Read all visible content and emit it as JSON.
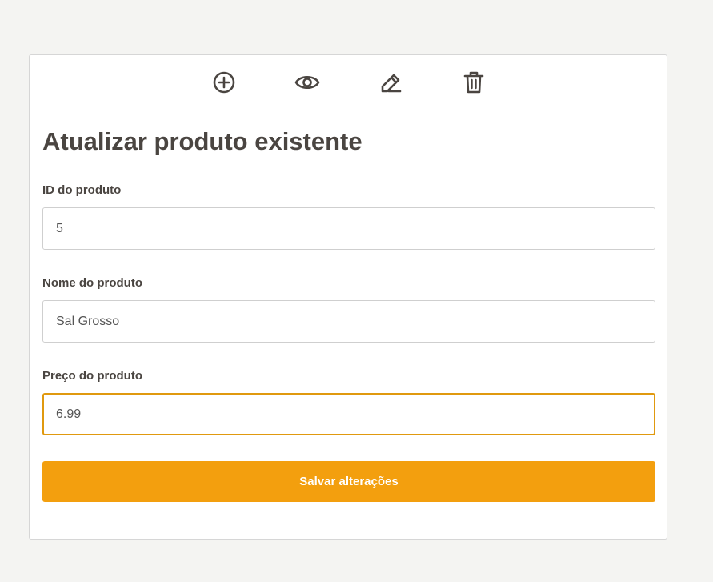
{
  "toolbar": {
    "icons": [
      "plus-circle-icon",
      "eye-icon",
      "pencil-icon",
      "trash-icon"
    ],
    "icon_color": "#4a4541"
  },
  "form": {
    "title": "Atualizar produto existente",
    "id_label": "ID do produto",
    "id_value": "5",
    "name_label": "Nome do produto",
    "name_value": "Sal Grosso",
    "price_label": "Preço do produto",
    "price_value": "6.99",
    "submit_label": "Salvar alterações"
  },
  "colors": {
    "accent": "#f39f0e",
    "focus_border": "#e0990f",
    "text": "#4a4541",
    "background": "#f4f4f2"
  }
}
